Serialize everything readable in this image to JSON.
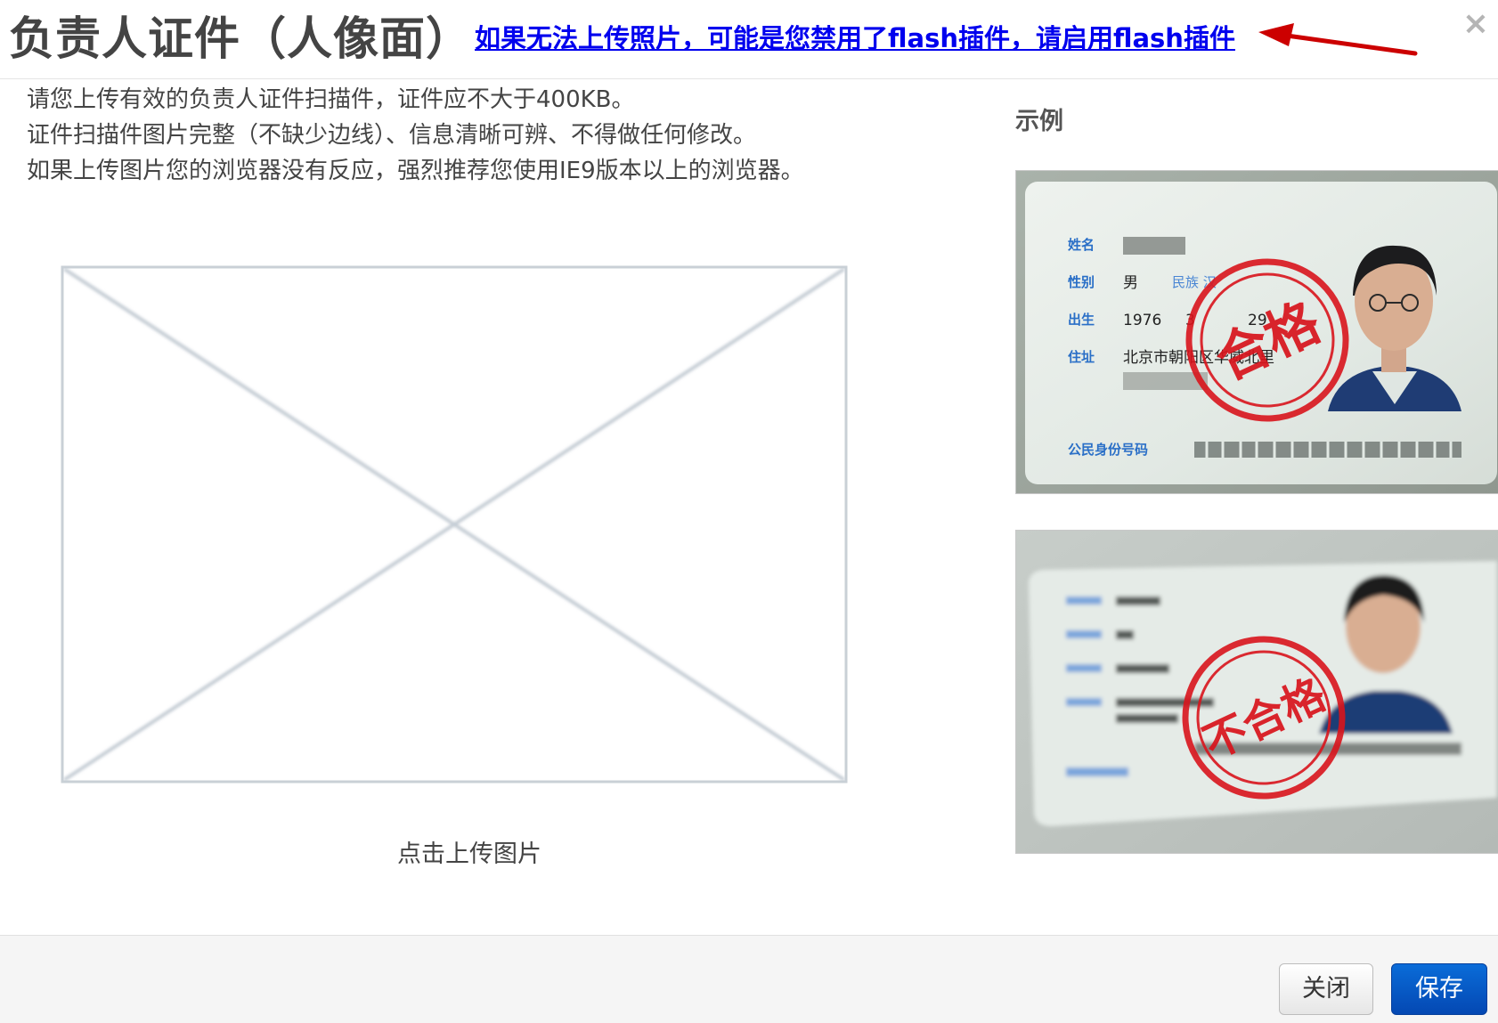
{
  "header": {
    "title": "负责人证件（人像面）",
    "flash_notice": "如果无法上传照片，可能是您禁用了flash插件，请启用flash插件",
    "close_symbol": "×"
  },
  "instructions": [
    "请您上传有效的负责人证件扫描件，证件应不大于400KB。",
    "证件扫描件图片完整（不缺少边线）、信息清晰可辨、不得做任何修改。",
    "如果上传图片您的浏览器没有反应，强烈推荐您使用IE9版本以上的浏览器。"
  ],
  "upload": {
    "label": "点击上传图片"
  },
  "examples": {
    "title": "示例",
    "good": {
      "field_labels": [
        "姓名",
        "性别",
        "出生",
        "住址",
        "公民身份号码"
      ],
      "gender": "男",
      "ethnicity": "民族 汉",
      "birth_year": "1976",
      "birth_month": "3",
      "birth_day": "29",
      "address": "北京市朝阳区华威北里",
      "stamp": "合格"
    },
    "bad": {
      "stamp": "不合格"
    }
  },
  "footer": {
    "close_label": "关闭",
    "save_label": "保存"
  },
  "colors": {
    "link": "#0000ee",
    "arrow": "#cc0000",
    "stamp_red": "#d8141c",
    "save_button": "#0554c4",
    "card_blue": "#2a6fc7"
  }
}
